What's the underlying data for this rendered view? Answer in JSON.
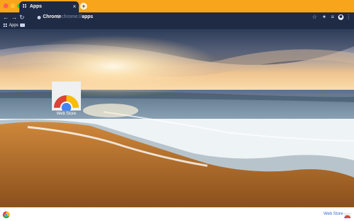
{
  "window": {
    "traffic_lights": [
      "#ff5f56",
      "#ffbd2e",
      "#27c93f"
    ]
  },
  "tab": {
    "title": "Apps",
    "close": "×",
    "new_tab": "+"
  },
  "toolbar": {
    "back": "←",
    "forward": "→",
    "reload": "↻",
    "chip": "Chrome",
    "separator": "|",
    "url_prefix": "chrome://",
    "url_host": "apps",
    "star": "☆",
    "extensions": "✦",
    "media": "≡",
    "menu": "⋮"
  },
  "bookmarks": {
    "apps_label": "Apps"
  },
  "apps": [
    {
      "name": "Web Store"
    }
  ],
  "footer": {
    "store_link": "Web Store"
  }
}
